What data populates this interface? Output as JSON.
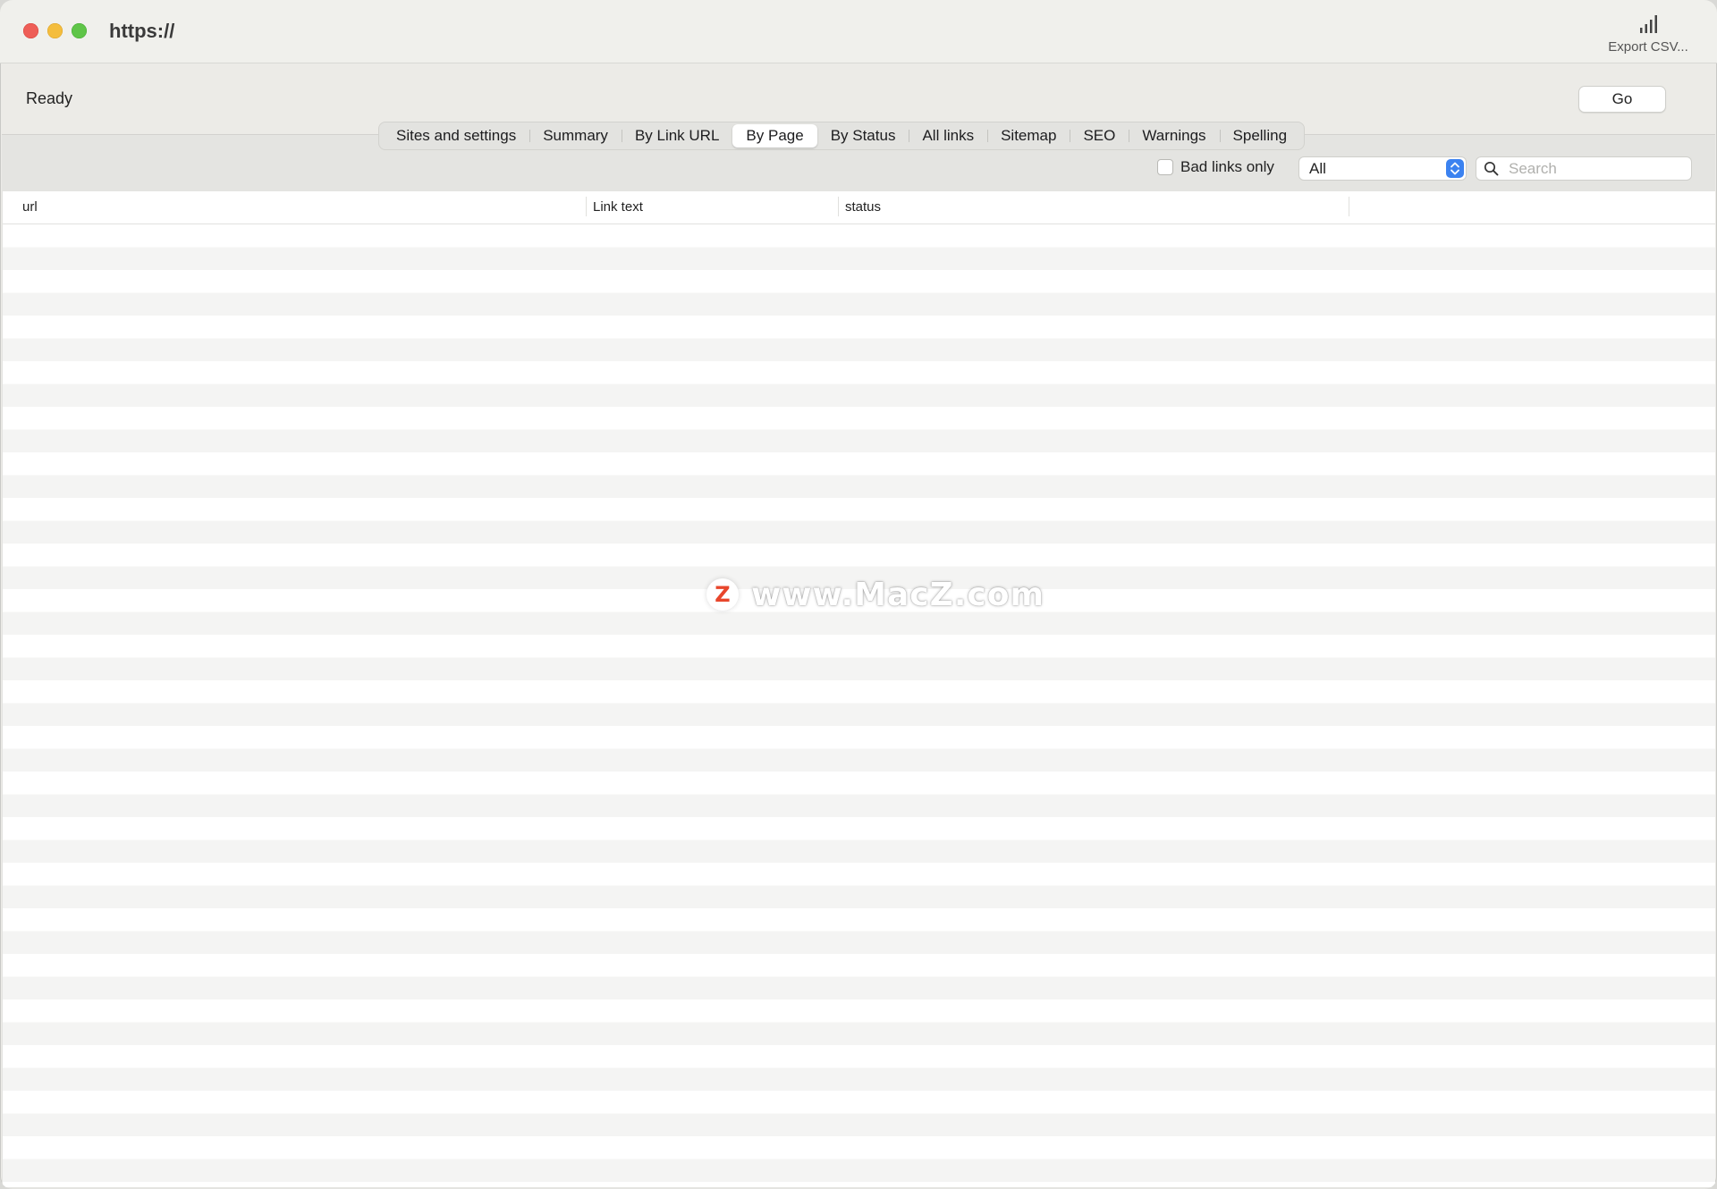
{
  "window": {
    "title": "https://",
    "export_label": "Export CSV..."
  },
  "status": {
    "text": "Ready",
    "go_label": "Go"
  },
  "tabs": [
    {
      "label": "Sites and settings",
      "active": false
    },
    {
      "label": "Summary",
      "active": false
    },
    {
      "label": "By Link URL",
      "active": false
    },
    {
      "label": "By Page",
      "active": true
    },
    {
      "label": "By Status",
      "active": false
    },
    {
      "label": "All links",
      "active": false
    },
    {
      "label": "Sitemap",
      "active": false
    },
    {
      "label": "SEO",
      "active": false
    },
    {
      "label": "Warnings",
      "active": false
    },
    {
      "label": "Spelling",
      "active": false
    }
  ],
  "filters": {
    "bad_links_label": "Bad links only",
    "bad_links_checked": false,
    "select_value": "All",
    "search_placeholder": "Search",
    "search_value": ""
  },
  "table": {
    "columns": [
      "url",
      "Link text",
      "status"
    ],
    "rows": []
  },
  "watermark": {
    "logo_letter": "Z",
    "text": "www.MacZ.com"
  },
  "colors": {
    "accent": "#3b82f0",
    "close": "#ee5e57",
    "minimize": "#f4bd3d",
    "zoom": "#5fc548",
    "watermark_logo": "#e8462c"
  },
  "icons": {
    "export": "bar-chart-icon",
    "search": "magnifier-icon",
    "select": "updown-chevron-icon"
  }
}
